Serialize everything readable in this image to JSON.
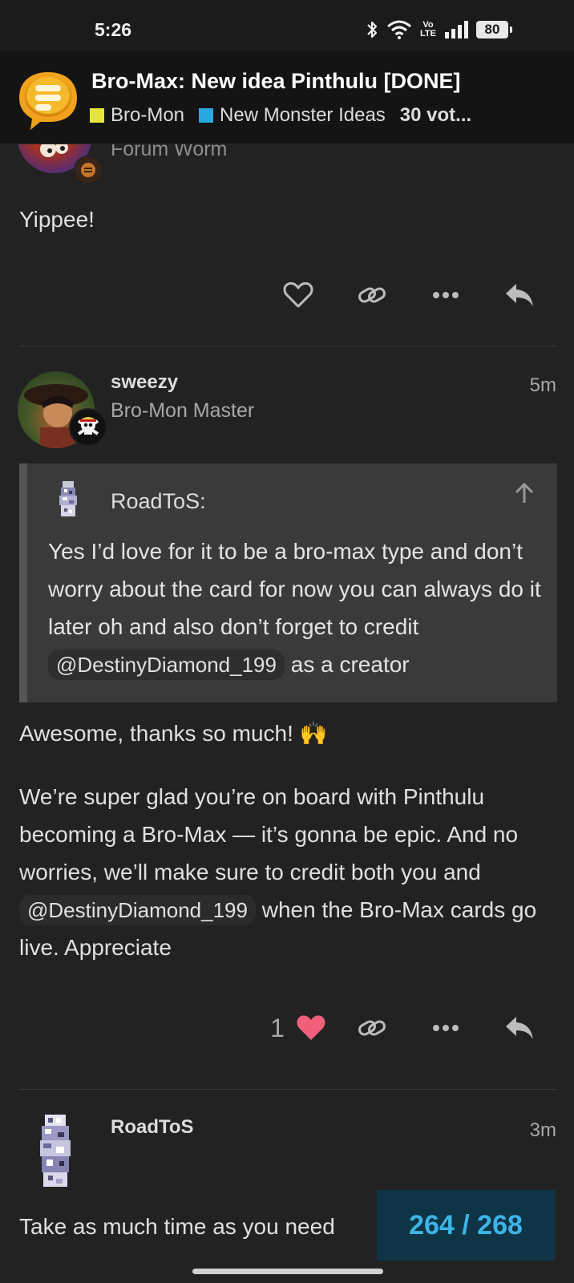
{
  "status_bar": {
    "time": "5:26",
    "volte_top": "Vo",
    "volte_bottom": "LTE",
    "battery": "80"
  },
  "topic": {
    "title": "Bro-Max: New idea Pinthulu [DONE]",
    "categories": [
      {
        "label": "Bro-Mon",
        "color": "#e5e53a"
      },
      {
        "label": "New Monster Ideas",
        "color": "#29a8e0"
      }
    ],
    "votes": "30 vot..."
  },
  "posts": [
    {
      "user_title": "Forum Worm",
      "text": "Yippee!"
    },
    {
      "username": "sweezy",
      "user_title": "Bro-Mon Master",
      "time": "5m",
      "quote": {
        "username": "RoadToS:",
        "text_before": "Yes I’d love for it to be a bro-max type and don’t worry about the card for now you can always do it later oh and also don’t forget to credit",
        "mention": "@DestinyDiamond_199",
        "text_after": "as a creator"
      },
      "paragraph1": "Awesome, thanks so much! 🙌",
      "paragraph2_before": "We’re super glad you’re on board with Pinthulu becoming a Bro-Max — it’s gonna be epic. And no worries, we’ll make sure to credit both you and",
      "paragraph2_mention": "@DestinyDiamond_199",
      "paragraph2_after": "when the Bro-Max cards go live. Appreciate",
      "like_count": "1"
    },
    {
      "username": "RoadToS",
      "time": "3m",
      "text": "Take as much time as you need"
    }
  ],
  "progress": "264 / 268",
  "colors": {
    "background": "#222222",
    "header": "#141414",
    "accent": "#3db4e6",
    "like": "#f0607a"
  }
}
